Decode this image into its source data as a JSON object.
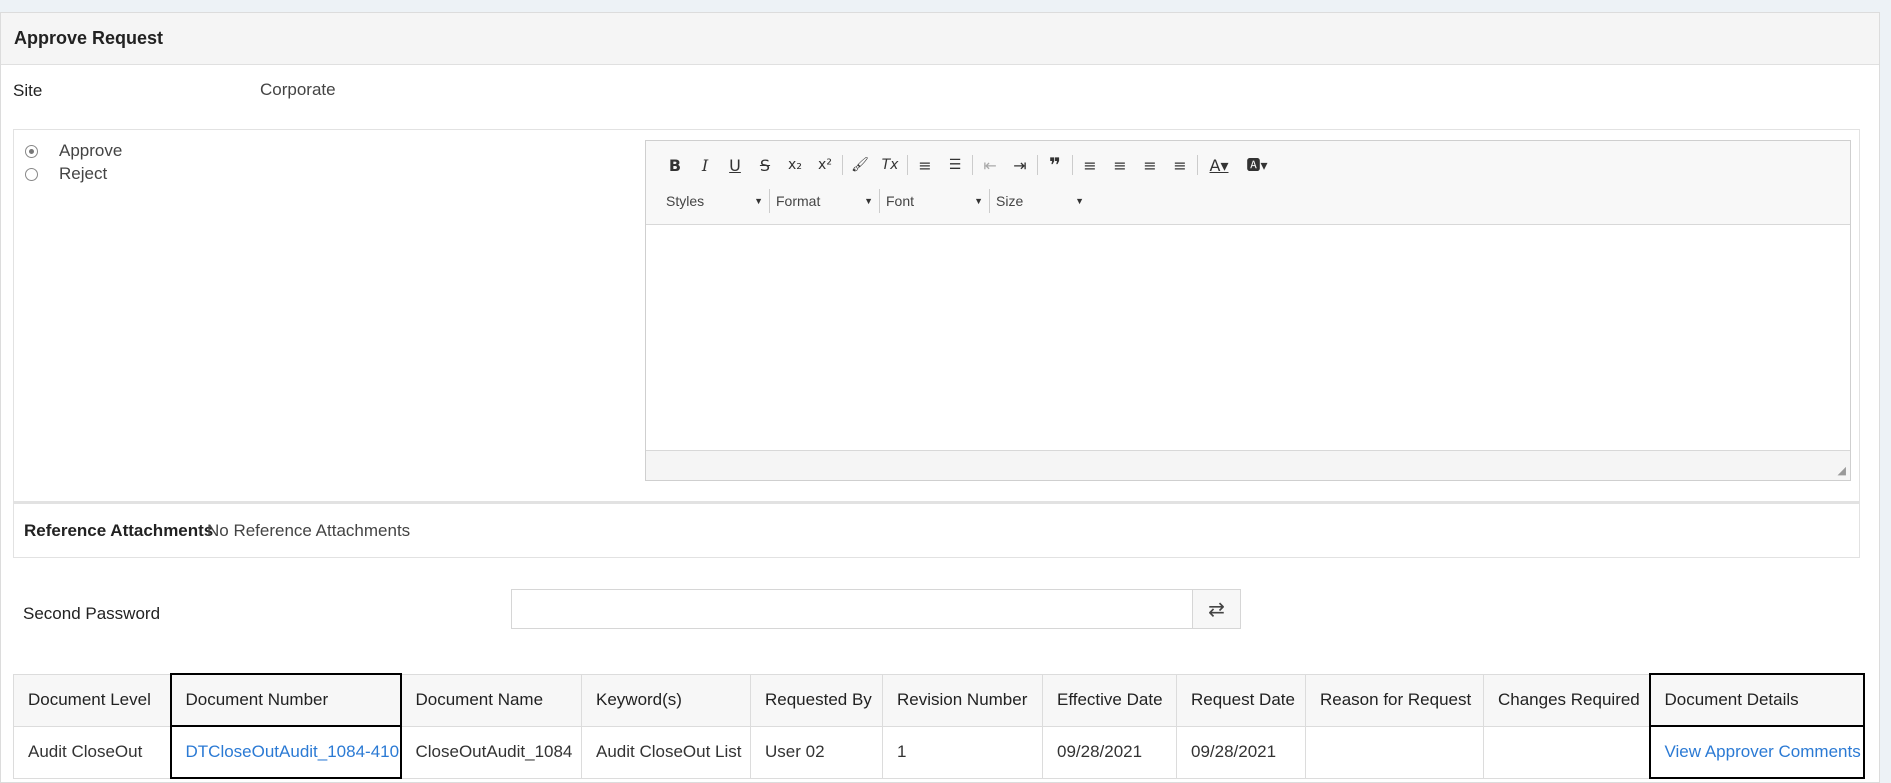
{
  "panel": {
    "title": "Approve Request"
  },
  "site": {
    "label": "Site",
    "value": "Corporate"
  },
  "decision": {
    "options": [
      {
        "label": "Approve",
        "checked": true
      },
      {
        "label": "Reject",
        "checked": false
      }
    ]
  },
  "editor": {
    "toolbar_buttons": [
      {
        "name": "bold-button",
        "glyph": "B"
      },
      {
        "name": "italic-button",
        "glyph": "I"
      },
      {
        "name": "underline-button",
        "glyph": "U"
      },
      {
        "name": "strikethrough-button",
        "glyph": "S"
      },
      {
        "name": "subscript-button",
        "glyph": "x₂"
      },
      {
        "name": "superscript-button",
        "glyph": "x²"
      },
      {
        "name": "copy-formatting-button",
        "glyph": "🖌"
      },
      {
        "name": "remove-format-button",
        "glyph": "Tx"
      },
      {
        "name": "numbered-list-button",
        "glyph": "≡"
      },
      {
        "name": "bulleted-list-button",
        "glyph": "☰"
      },
      {
        "name": "decrease-indent-button",
        "glyph": "⇤"
      },
      {
        "name": "increase-indent-button",
        "glyph": "⇥"
      },
      {
        "name": "blockquote-button",
        "glyph": "❞"
      },
      {
        "name": "align-left-button",
        "glyph": "≡"
      },
      {
        "name": "align-center-button",
        "glyph": "≡"
      },
      {
        "name": "align-right-button",
        "glyph": "≡"
      },
      {
        "name": "justify-button",
        "glyph": "≡"
      },
      {
        "name": "text-color-button",
        "glyph": "A▾"
      },
      {
        "name": "background-color-button",
        "glyph": "🅰▾"
      }
    ],
    "combos": [
      {
        "label": "Styles"
      },
      {
        "label": "Format"
      },
      {
        "label": "Font"
      },
      {
        "label": "Size"
      }
    ]
  },
  "reference": {
    "label": "Reference Attachments",
    "value": "No Reference Attachments"
  },
  "second_password": {
    "label": "Second Password",
    "value": ""
  },
  "table": {
    "headers": [
      "Document Level",
      "Document Number",
      "Document Name",
      "Keyword(s)",
      "Requested By",
      "Revision Number",
      "Effective Date",
      "Request Date",
      "Reason for Request",
      "Changes Required",
      "Document Details"
    ],
    "row": {
      "document_level": "Audit CloseOut",
      "document_number": "DTCloseOutAudit_1084-410",
      "document_name": "CloseOutAudit_1084",
      "keywords": "Audit CloseOut List",
      "requested_by": "User 02",
      "revision_number": "1",
      "effective_date": "09/28/2021",
      "request_date": "09/28/2021",
      "reason_for_request": "",
      "changes_required": "",
      "document_details": "View Approver Comments"
    }
  },
  "colors": {
    "link": "#2b7ad4",
    "header_bg": "#f5f5f5",
    "highlight_border": "#000000"
  }
}
